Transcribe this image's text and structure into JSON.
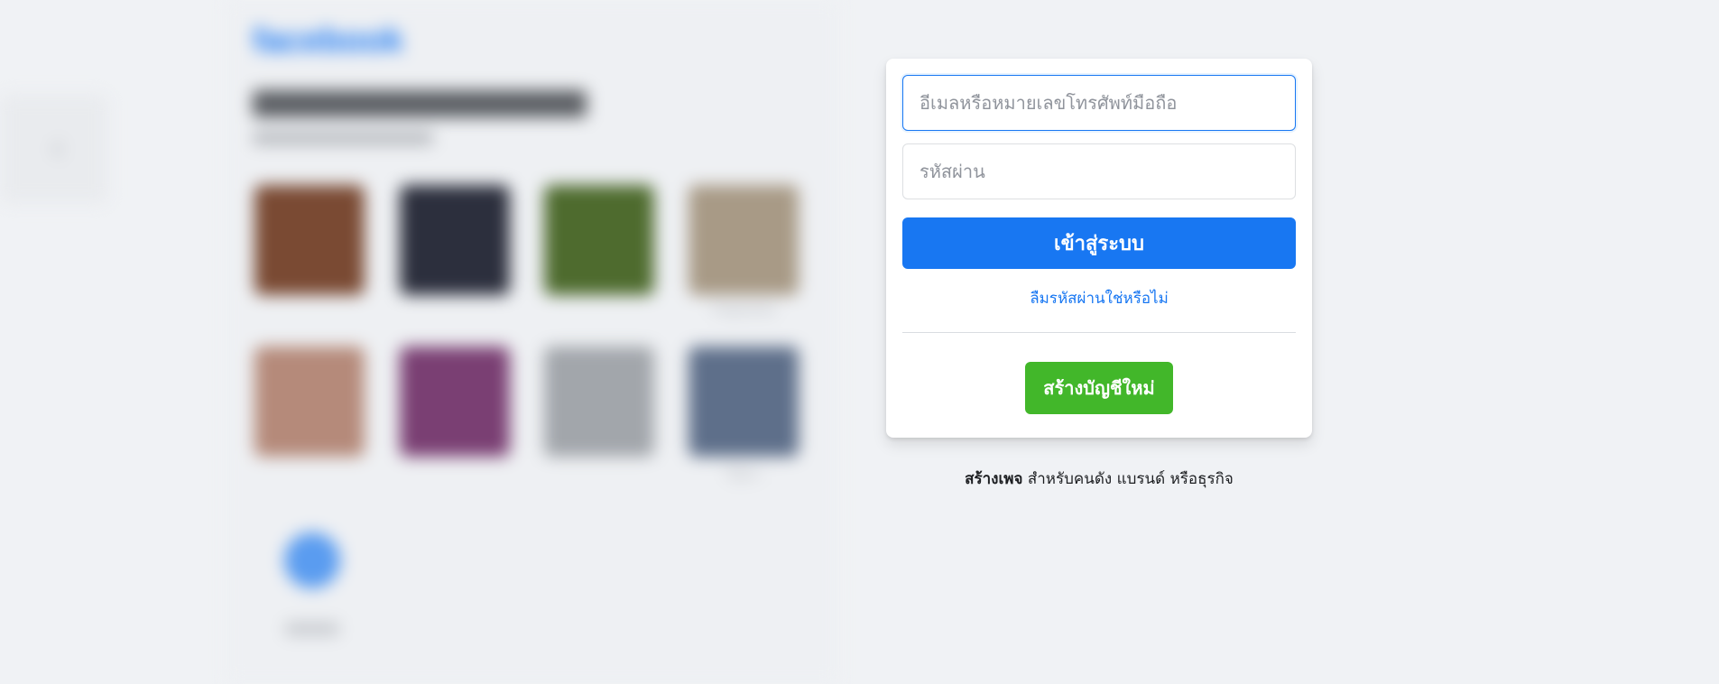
{
  "background": {
    "logo_text": "facebook",
    "recent_logins": [
      {
        "name": "",
        "color": "#7a4a33"
      },
      {
        "name": "",
        "color": "#2c2f3d"
      },
      {
        "name": "",
        "color": "#4e6b2e"
      },
      {
        "name": "Papissha",
        "color": "#a89a86"
      },
      {
        "name": "",
        "color": "#b58a7a"
      },
      {
        "name": "",
        "color": "#7a3f73"
      },
      {
        "name": "",
        "color": "#a2a6ab"
      },
      {
        "name": "ไม้ทา",
        "color": "#5e6f8a"
      }
    ]
  },
  "login": {
    "email_placeholder": "อีเมลหรือหมายเลขโทรศัพท์มือถือ",
    "password_placeholder": "รหัสผ่าน",
    "login_button": "เข้าสู่ระบบ",
    "forgot_password": "ลืมรหัสผ่านใช่หรือไม่",
    "create_account": "สร้างบัญชีใหม่"
  },
  "create_page": {
    "link_text": "สร้างเพจ",
    "rest_text": " สำหรับคนดัง แบรนด์ หรือธุรกิจ"
  },
  "colors": {
    "primary": "#1877f2",
    "create_green": "#42b72a",
    "page_bg": "#f0f2f5"
  }
}
